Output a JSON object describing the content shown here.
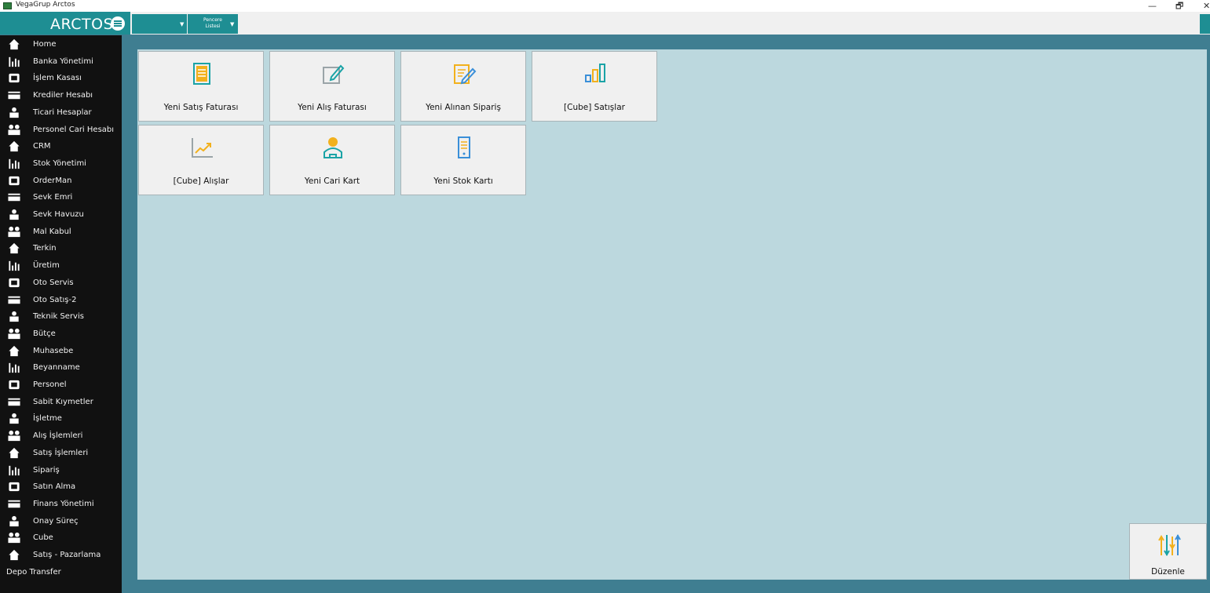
{
  "window": {
    "title": "VegaGrup Arctos",
    "controls": {
      "minimize": "—",
      "restore": "🗗",
      "close": "✕"
    }
  },
  "header": {
    "logo_text": "ARCTOS",
    "window_list_line1": "Pencere",
    "window_list_line2": "Listesi"
  },
  "colors": {
    "accent": "#1e8e93",
    "sidebar_bg": "#111111",
    "workspace_bg": "#bcd8de",
    "frame_bg": "#3f7e91",
    "tile_icon_yellow": "#f2b11d",
    "tile_icon_teal": "#1aa3a6",
    "tile_icon_blue": "#3a8fd8"
  },
  "sidebar": {
    "items": [
      {
        "label": "Home",
        "icon": "home-icon"
      },
      {
        "label": "Banka Yönetimi",
        "icon": "bank-chart-icon"
      },
      {
        "label": "İşlem Kasası",
        "icon": "cashbox-icon"
      },
      {
        "label": "Krediler Hesabı",
        "icon": "credit-card-icon"
      },
      {
        "label": "Ticari Hesaplar",
        "icon": "merchant-icon"
      },
      {
        "label": "Personel Cari Hesabı",
        "icon": "staff-account-icon"
      },
      {
        "label": "CRM",
        "icon": "crm-person-icon"
      },
      {
        "label": "Stok Yönetimi",
        "icon": "stock-icon"
      },
      {
        "label": "OrderMan",
        "icon": "orderman-icon"
      },
      {
        "label": "Sevk Emri",
        "icon": "dispatch-order-icon"
      },
      {
        "label": "Sevk Havuzu",
        "icon": "checkmark-icon"
      },
      {
        "label": "Mal Kabul",
        "icon": "goods-receipt-icon"
      },
      {
        "label": "Terkin",
        "icon": "write-off-icon"
      },
      {
        "label": "Üretim",
        "icon": "production-icon"
      },
      {
        "label": "Oto Servis",
        "icon": "car-service-icon"
      },
      {
        "label": "Oto Satış-2",
        "icon": "car-sales-icon"
      },
      {
        "label": "Teknik Servis",
        "icon": "tools-icon"
      },
      {
        "label": "Bütçe",
        "icon": "calculator-icon"
      },
      {
        "label": "Muhasebe",
        "icon": "accounting-icon"
      },
      {
        "label": "Beyanname",
        "icon": "declaration-icon"
      },
      {
        "label": "Personel",
        "icon": "personnel-icon"
      },
      {
        "label": "Sabit Kıymetler",
        "icon": "fixed-assets-icon"
      },
      {
        "label": "İşletme",
        "icon": "laptop-icon"
      },
      {
        "label": "Alış İşlemleri",
        "icon": "purchase-icon"
      },
      {
        "label": "Satış İşlemleri",
        "icon": "sales-icon"
      },
      {
        "label": "Sipariş",
        "icon": "cart-icon"
      },
      {
        "label": "Satın Alma",
        "icon": "procurement-icon"
      },
      {
        "label": "Finans Yönetimi",
        "icon": "finance-chart-icon"
      },
      {
        "label": "Onay Süreç",
        "icon": "approval-icon"
      },
      {
        "label": "Cube",
        "icon": "cube-grid-icon"
      },
      {
        "label": "Satış - Pazarlama",
        "icon": "marketing-runner-icon"
      },
      {
        "label": "Depo Transfer",
        "icon": ""
      }
    ]
  },
  "tiles": [
    {
      "label": "Yeni Satış Faturası",
      "icon": "document-icon"
    },
    {
      "label": "Yeni Alış Faturası",
      "icon": "edit-pencil-icon"
    },
    {
      "label": "Yeni Alınan Sipariş",
      "icon": "edit-document-icon"
    },
    {
      "label": "[Cube] Satışlar",
      "icon": "bar-chart-icon"
    },
    {
      "label": "[Cube] Alışlar",
      "icon": "trend-line-icon"
    },
    {
      "label": "Yeni Cari Kart",
      "icon": "user-card-icon"
    },
    {
      "label": "Yeni Stok Kartı",
      "icon": "stock-card-icon"
    }
  ],
  "edit_button": {
    "label": "Düzenle",
    "icon": "sliders-icon"
  }
}
